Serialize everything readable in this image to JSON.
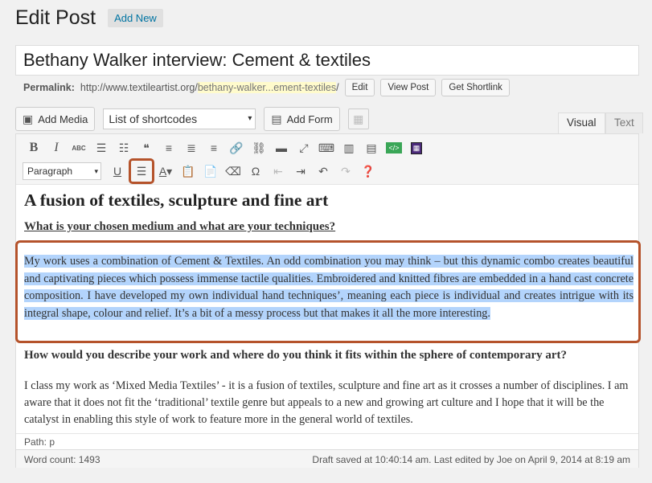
{
  "header": {
    "title": "Edit Post",
    "add_new": "Add New"
  },
  "post": {
    "title": "Bethany Walker interview: Cement & textiles"
  },
  "permalink": {
    "label": "Permalink:",
    "base": "http://www.textileartist.org/",
    "slug": "bethany-walker...ement-textiles",
    "trail": "/",
    "edit": "Edit",
    "view": "View Post",
    "shortlink": "Get Shortlink"
  },
  "media": {
    "add_media": "Add Media",
    "shortcodes": "List of shortcodes",
    "add_form": "Add Form"
  },
  "tabs": {
    "visual": "Visual",
    "text": "Text"
  },
  "toolbar": {
    "format": "Paragraph",
    "strike_label": "ABC",
    "html_label": "</>"
  },
  "content": {
    "heading": "A fusion of textiles, sculpture and fine art",
    "q1": "What is your chosen medium and what are your techniques?",
    "p1": "My work uses a combination of Cement & Textiles. An odd combination you may think – but this dynamic combo creates beautiful and captivating pieces which possess immense tactile qualities. Embroidered and knitted fibres are embedded in a hand cast concrete composition. I have developed my own individual hand techniques’, meaning each piece is individual and creates intrigue with its integral shape, colour and relief. It’s a bit of a messy process but that makes it all the more interesting.",
    "q2": "How would you describe your work and where do you think it fits within the sphere of contemporary art?",
    "p2": "I class my work as ‘Mixed Media Textiles’ -  it is a fusion of textiles, sculpture and fine art as it crosses a number of disciplines. I am aware that it does not fit the ‘traditional’ textile genre but appeals to a new and growing art culture and I hope that it will be the catalyst in enabling this style of work to feature more in the general world of textiles."
  },
  "path": "Path: p",
  "status": {
    "word_count": "Word count: 1493",
    "saved": "Draft saved at 10:40:14 am. Last edited by Joe on April 9, 2014 at 8:19 am"
  },
  "colors": {
    "accent_highlight": "#b5532b",
    "selection": "#b3d4fc",
    "link": "#0074a2"
  }
}
